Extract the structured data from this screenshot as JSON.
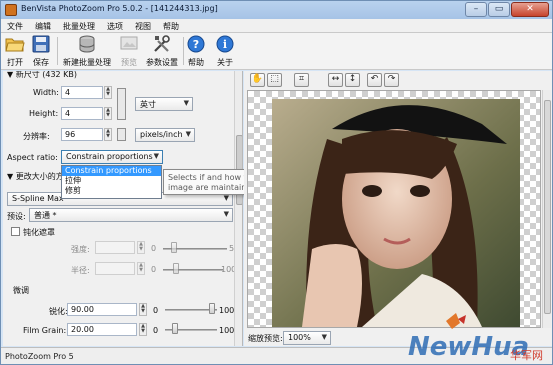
{
  "window": {
    "title": "BenVista PhotoZoom Pro 5.0.2 - [141244313.jpg]",
    "controls": [
      "–",
      "▭",
      "✕"
    ]
  },
  "menu": [
    "文件",
    "编辑",
    "批量处理",
    "选项",
    "视图",
    "帮助"
  ],
  "toolbar": {
    "open": "打开",
    "save": "保存",
    "batch": "新建批量处理",
    "preview": "预览",
    "settings": "参数设置",
    "help": "帮助",
    "about": "关于"
  },
  "left": {
    "new_size_header": "▼ 新尺寸 (432 KB)",
    "width_label": "Width:",
    "width_value": "4",
    "height_label": "Height:",
    "height_value": "4",
    "unit_value": "英寸",
    "resolution_label": "分辨率:",
    "resolution_value": "96",
    "resolution_unit": "pixels/inch",
    "aspect_label": "Aspect ratio:",
    "aspect_value": "Constrain proportions",
    "aspect_options": [
      "Constrain proportions",
      "拉伸",
      "修剪"
    ],
    "resize_header": "▼ 更改大小的方",
    "method_value": "S-Spline Max",
    "preset_label": "预设:",
    "preset_value": "普通 *",
    "unsharp_label": "钝化遮罩",
    "strength_label": "强度:",
    "strength_min": "0",
    "strength_max": "5",
    "radius_label": "半径:",
    "radius_min": "0",
    "radius_max": "100",
    "finetune_header": "微调",
    "sharpen_label": "锐化:",
    "sharpen_value": "90.00",
    "sharpen_min": "0",
    "sharpen_max": "100",
    "sharpen_level": 0.9,
    "grain_label": "Film Grain:",
    "grain_value": "20.00",
    "grain_min": "0",
    "grain_max": "100",
    "grain_level": 0.2
  },
  "tooltip": "Selects if and how the width and height proportions of the original image are maintained",
  "right": {
    "zoom_label": "缩放预览:",
    "zoom_value": "100%"
  },
  "status": "PhotoZoom Pro 5",
  "watermark": {
    "brand": "NewHua",
    "text": "华军网"
  }
}
